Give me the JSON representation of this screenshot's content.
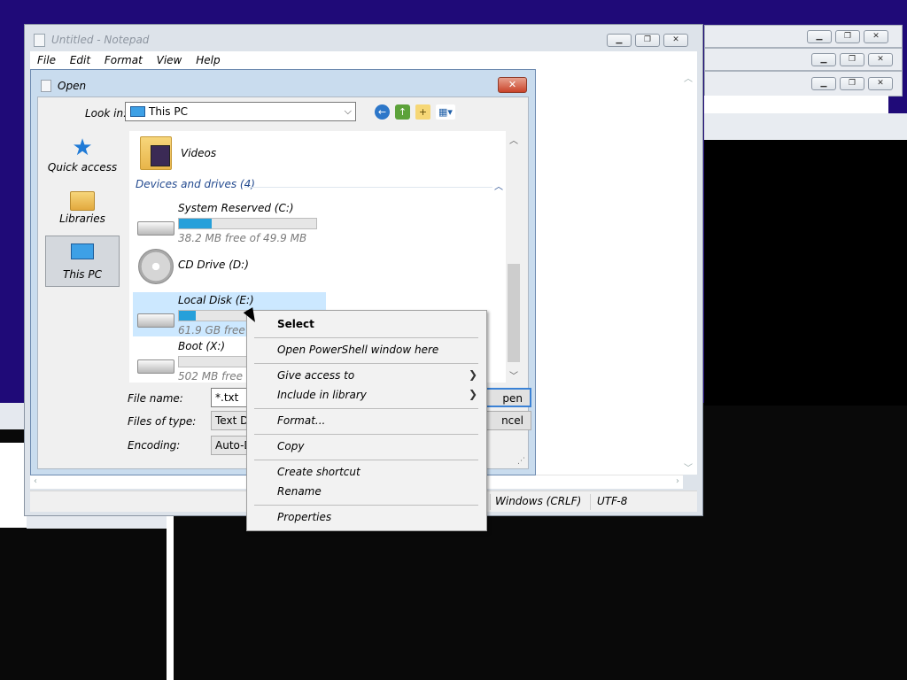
{
  "notepad": {
    "title": "Untitled - Notepad",
    "menu": [
      "File",
      "Edit",
      "Format",
      "View",
      "Help"
    ],
    "status": {
      "line_ending": "Windows (CRLF)",
      "encoding": "UTF-8"
    }
  },
  "dialog": {
    "title": "Open",
    "close_glyph": "✕",
    "look_in_label": "Look in:",
    "look_in_value": "This PC",
    "places": [
      {
        "label": "Quick access",
        "icon": "star-icon"
      },
      {
        "label": "Libraries",
        "icon": "libraries-icon"
      },
      {
        "label": "This PC",
        "icon": "computer-icon",
        "selected": true
      }
    ],
    "list": {
      "folder_item": "Videos",
      "group_header": "Devices and drives (4)",
      "drives": [
        {
          "name": "System Reserved (C:)",
          "free": "38.2 MB free of 49.9 MB",
          "used_fraction": 0.24
        },
        {
          "name": "CD Drive (D:)",
          "free": "",
          "used_fraction": null
        },
        {
          "name": "Local Disk (E:)",
          "free": "61.9 GB free of",
          "used_fraction": 0.12,
          "selected": true
        },
        {
          "name": "Boot (X:)",
          "free": "502 MB free of",
          "used_fraction": 0.0
        }
      ]
    },
    "file_name_label": "File name:",
    "file_name_value": "*.txt",
    "files_of_type_label": "Files of type:",
    "files_of_type_value": "Text Do",
    "encoding_label": "Encoding:",
    "encoding_value": "Auto-De",
    "open_button": "pen",
    "cancel_button": "ncel"
  },
  "context_menu": {
    "items": [
      {
        "label": "Select",
        "bold": true
      },
      {
        "label": "Open PowerShell window here"
      },
      {
        "label": "Give access to",
        "submenu": true
      },
      {
        "label": "Include in library",
        "submenu": true
      },
      {
        "label": "Format..."
      },
      {
        "label": "Copy"
      },
      {
        "label": "Create shortcut"
      },
      {
        "label": "Rename"
      },
      {
        "label": "Properties"
      }
    ]
  },
  "colors": {
    "desktop": "#1f0a78",
    "selection": "#cce8ff",
    "drive_bar": "#26a0da",
    "close_button": "#c9432a"
  }
}
